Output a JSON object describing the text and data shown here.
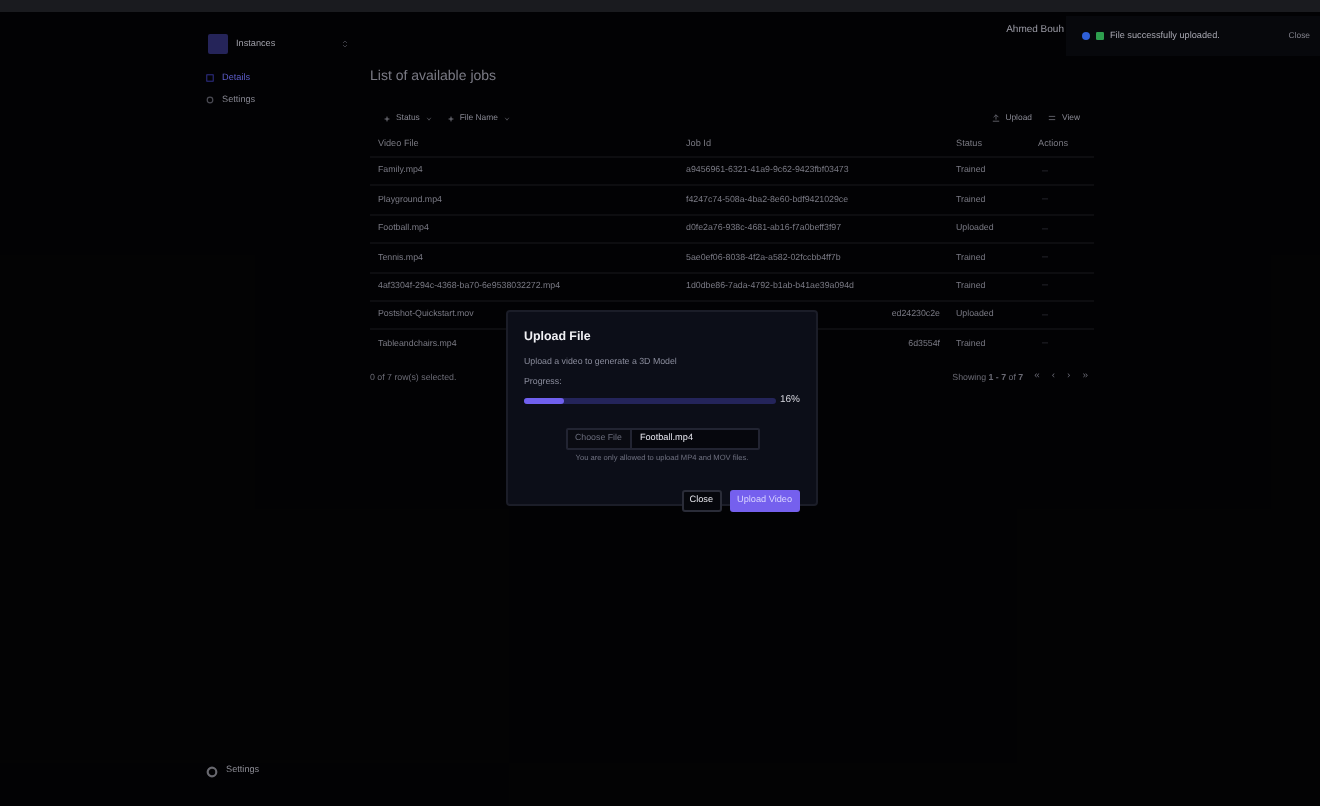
{
  "sidebar": {
    "workspace": "Instances",
    "items": [
      {
        "label": "Details",
        "selected": true
      },
      {
        "label": "Settings",
        "selected": false
      }
    ],
    "footer": "Settings"
  },
  "header": {
    "user": "Ahmed Bouh"
  },
  "page": {
    "title": "List of available jobs",
    "filters": [
      "Status",
      "File Name"
    ],
    "actions": [
      "Upload",
      "View"
    ]
  },
  "table": {
    "columns": [
      "Video File",
      "Job Id",
      "Status",
      "Actions"
    ],
    "rows": [
      {
        "video_file": "Family.mp4",
        "job_id": "a9456961-6321-41a9-9c62-9423fbf03473",
        "status": "Trained"
      },
      {
        "video_file": "Playground.mp4",
        "job_id": "f4247c74-508a-4ba2-8e60-bdf9421029ce",
        "status": "Trained"
      },
      {
        "video_file": "Football.mp4",
        "job_id": "d0fe2a76-938c-4681-ab16-f7a0beff3f97",
        "status": "Uploaded"
      },
      {
        "video_file": "Tennis.mp4",
        "job_id": "5ae0ef06-8038-4f2a-a582-02fccbb4ff7b",
        "status": "Trained"
      },
      {
        "video_file": "4af3304f-294c-4368-ba70-6e9538032272.mp4",
        "job_id": "1d0dbe86-7ada-4792-b1ab-b41ae39a094d",
        "status": "Trained"
      },
      {
        "video_file": "Postshot-Quickstart.mov",
        "job_id": "ed24230c2e",
        "status": "Uploaded"
      },
      {
        "video_file": "Tableandchairs.mp4",
        "job_id": "6d3554f",
        "status": "Trained"
      }
    ]
  },
  "footer": {
    "selection": "0 of 7 row(s) selected.",
    "showing": "Showing **1 - 7** of **7**",
    "pager": [
      "«",
      "‹",
      "›",
      "»"
    ]
  },
  "modal": {
    "title": "Upload File",
    "description": "Upload a video to generate a 3D Model",
    "progress_label": "Progress:",
    "level": 0.16,
    "reading": "16%",
    "file_button": "Choose File",
    "file_name": "Football.mp4",
    "hint": "You are only allowed to upload MP4 and MOV files.",
    "buttons": [
      {
        "label": "Close",
        "kind": "secondary"
      },
      {
        "label": "Upload Video",
        "kind": "primary"
      }
    ]
  },
  "toast": {
    "message": "File successfully uploaded.",
    "close": "Close"
  }
}
